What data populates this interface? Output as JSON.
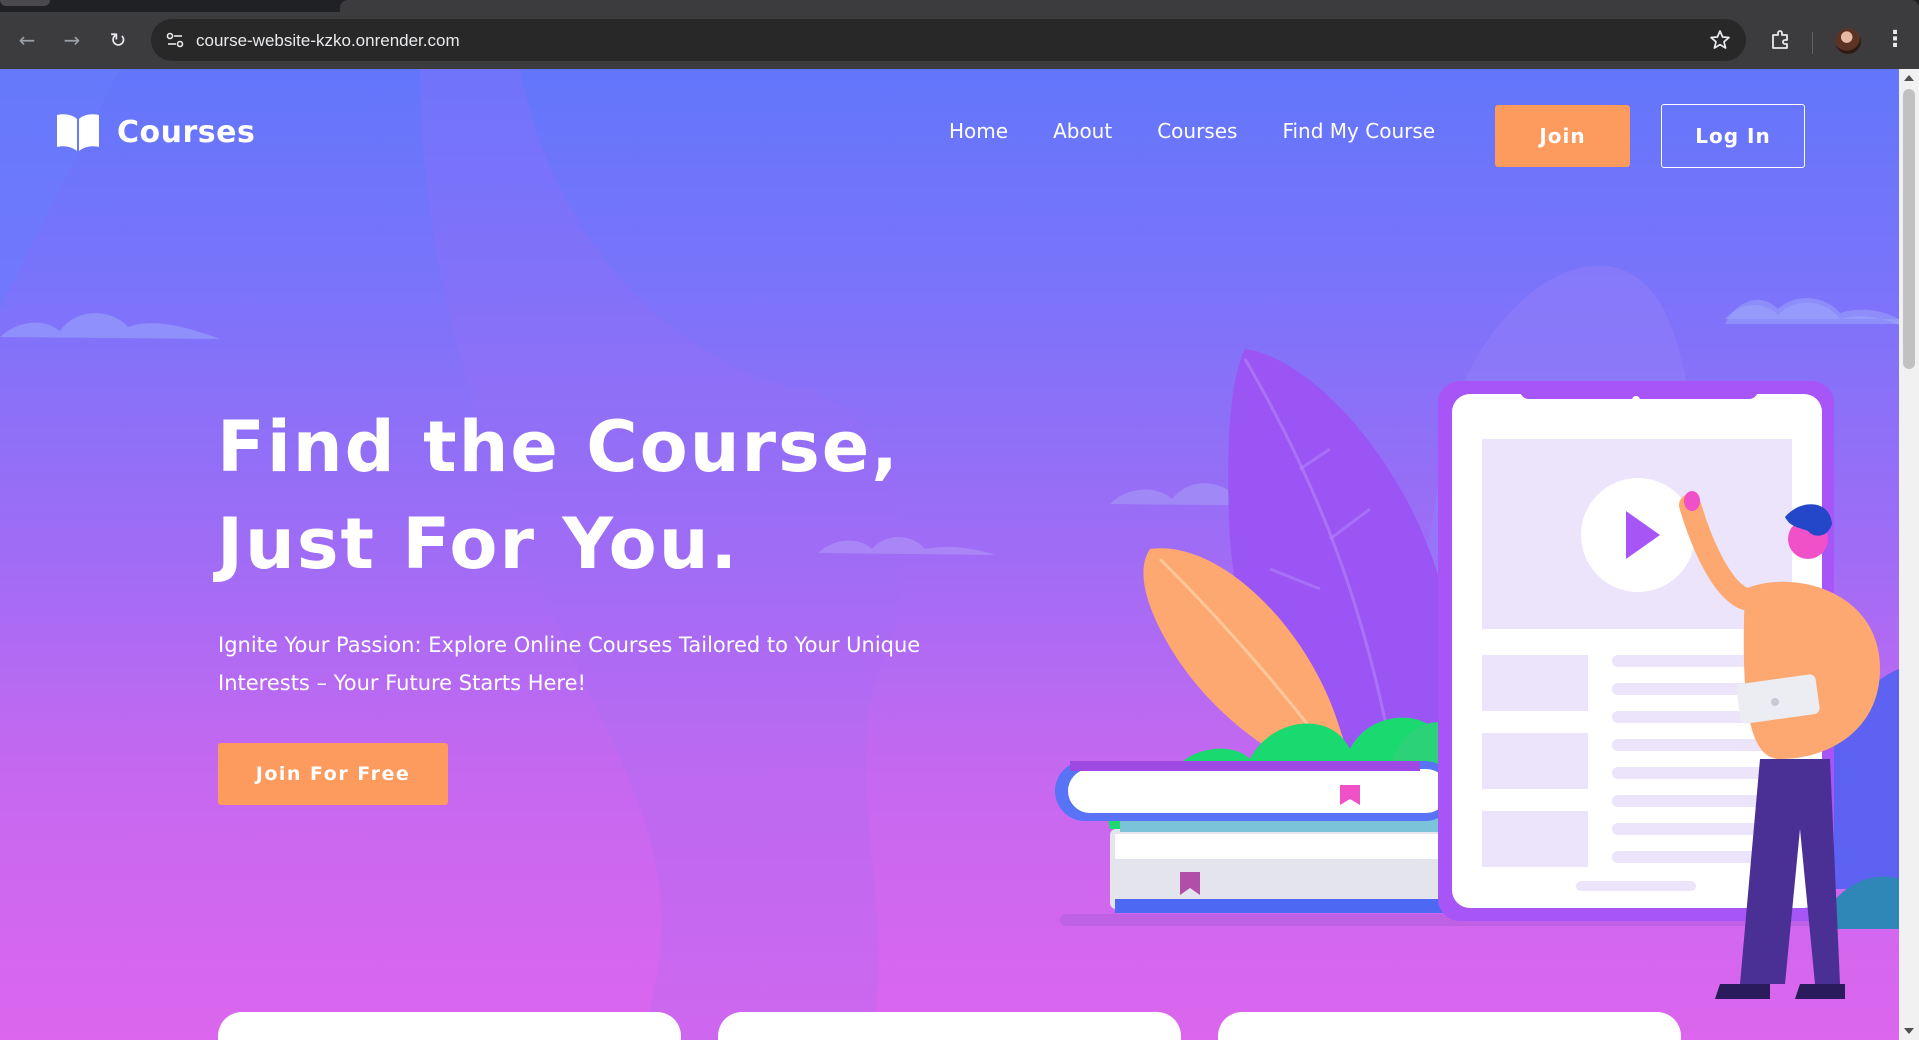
{
  "browser": {
    "url": "course-website-kzko.onrender.com",
    "icons": [
      "back-icon",
      "forward-icon",
      "reload-icon",
      "site-info-icon",
      "star-icon",
      "extensions-icon",
      "profile-avatar",
      "more-menu-icon"
    ]
  },
  "header": {
    "logo_text": "Courses",
    "nav": [
      "Home",
      "About",
      "Courses",
      "Find My Course"
    ],
    "join_label": "Join",
    "login_label": "Log In"
  },
  "hero": {
    "title_line1": "Find the Course,",
    "title_line2": "Just For You.",
    "subtitle": "Ignite Your Passion: Explore Online Courses Tailored to Your Unique Interests – Your Future Starts Here!",
    "cta_label": "Join For Free"
  },
  "colors": {
    "accent": "#fd9a5e",
    "gradient_top": "#6276fb",
    "gradient_bottom": "#dc66ee",
    "text": "#ffffff"
  }
}
